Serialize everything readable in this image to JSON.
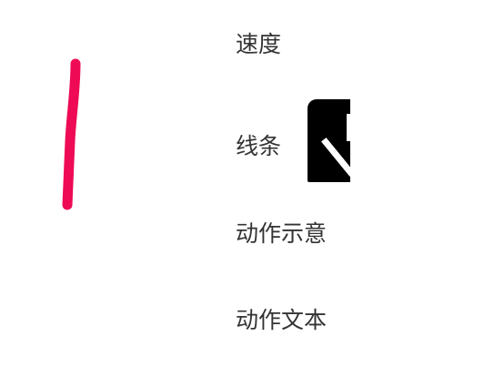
{
  "canvas": {
    "stroke_color": "#EE0A55",
    "description_name": "drawn-stroke"
  },
  "settings": {
    "speed_label": "速度",
    "line_label": "线条",
    "action_hint_label": "动作示意",
    "action_text_label": "动作文本"
  },
  "line_tile": {
    "background": "#000000",
    "glyph_color": "#FFFFFF",
    "icon": "line-style-icon"
  }
}
